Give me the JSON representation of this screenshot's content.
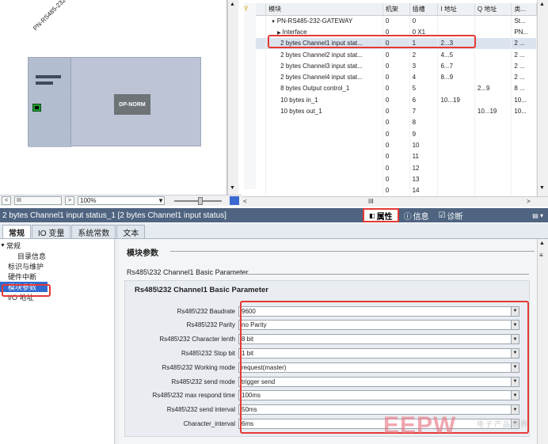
{
  "device_view": {
    "device_label": "PN-RS485-232-GA...",
    "module_label": "DP-NORM",
    "zoom": "100%",
    "scroll_left": "<",
    "scroll_left2": "III",
    "scroll_right": ">"
  },
  "table": {
    "columns": [
      "",
      "模块",
      "机架",
      "插槽",
      "I 地址",
      "Q 地址",
      "类..."
    ],
    "rows": [
      {
        "module": "PN-RS485-232-GATEWAY",
        "rack": "0",
        "slot": "0",
        "i": "",
        "q": "",
        "type": "St..."
      },
      {
        "module": "Interface",
        "rack": "0",
        "slot": "0 X1",
        "i": "",
        "q": "",
        "type": "PN..."
      },
      {
        "module": "2 bytes Channel1 input stat...",
        "rack": "0",
        "slot": "1",
        "i": "2...3",
        "q": "",
        "type": "2 ..."
      },
      {
        "module": "2 bytes Channel2 input stat...",
        "rack": "0",
        "slot": "2",
        "i": "4...5",
        "q": "",
        "type": "2 ..."
      },
      {
        "module": "2 bytes Channel3 input stat...",
        "rack": "0",
        "slot": "3",
        "i": "6...7",
        "q": "",
        "type": "2 ..."
      },
      {
        "module": "2 bytes Channel4 input stat...",
        "rack": "0",
        "slot": "4",
        "i": "8...9",
        "q": "",
        "type": "2 ..."
      },
      {
        "module": "8 bytes Output control_1",
        "rack": "0",
        "slot": "5",
        "i": "",
        "q": "2...9",
        "type": "8 ..."
      },
      {
        "module": "10 bytes in_1",
        "rack": "0",
        "slot": "6",
        "i": "10...19",
        "q": "",
        "type": "10..."
      },
      {
        "module": "10 bytes out_1",
        "rack": "0",
        "slot": "7",
        "i": "",
        "q": "10...19",
        "type": "10..."
      },
      {
        "module": "",
        "rack": "0",
        "slot": "8",
        "i": "",
        "q": "",
        "type": ""
      },
      {
        "module": "",
        "rack": "0",
        "slot": "9",
        "i": "",
        "q": "",
        "type": ""
      },
      {
        "module": "",
        "rack": "0",
        "slot": "10",
        "i": "",
        "q": "",
        "type": ""
      },
      {
        "module": "",
        "rack": "0",
        "slot": "11",
        "i": "",
        "q": "",
        "type": ""
      },
      {
        "module": "",
        "rack": "0",
        "slot": "12",
        "i": "",
        "q": "",
        "type": ""
      },
      {
        "module": "",
        "rack": "0",
        "slot": "13",
        "i": "",
        "q": "",
        "type": ""
      },
      {
        "module": "",
        "rack": "0",
        "slot": "14",
        "i": "",
        "q": "",
        "type": ""
      }
    ]
  },
  "title_bar": {
    "title": "2 bytes Channel1 input status_1 [2 bytes Channel1 input status]",
    "properties_tab": "属性",
    "info_tab": "信息",
    "diag_tab": "诊断"
  },
  "tabs": [
    "常规",
    "IO 变量",
    "系统常数",
    "文本"
  ],
  "nav": {
    "general": "常规",
    "catalog": "目录信息",
    "id_maint": "标识与维护",
    "hw_int": "硬件中断",
    "module_params": "模块参数",
    "io_addr": "I/O 地址"
  },
  "content": {
    "section_title": "模块参数",
    "subsection_title": "Rs485\\232 Channel1 Basic Parameter",
    "panel_title": "Rs485\\232 Channel1 Basic Parameter",
    "params": [
      {
        "label": "Rs485\\232  Baudrate",
        "value": "9600"
      },
      {
        "label": "Rs485\\232  Parity",
        "value": "no Parity"
      },
      {
        "label": "Rs485\\232  Character lenth",
        "value": "8 bit"
      },
      {
        "label": "Rs485\\232 Stop bit",
        "value": "1 bit"
      },
      {
        "label": "Rs485\\232 Working mode",
        "value": "request(master)"
      },
      {
        "label": "Rs485\\232 send mode",
        "value": "trigger send"
      },
      {
        "label": "Rs485\\232 max respond time",
        "value": "100ms"
      },
      {
        "label": "Rs485\\232 send interval",
        "value": "50ms"
      },
      {
        "label": "Character_interval",
        "value": "6ms"
      }
    ]
  },
  "watermark": {
    "main": "EEPW",
    "sub": "电子产品世界"
  },
  "colors": {
    "highlight": "#e53935",
    "title_bar": "#4e6480",
    "selected_row": "#dbe3ef"
  }
}
